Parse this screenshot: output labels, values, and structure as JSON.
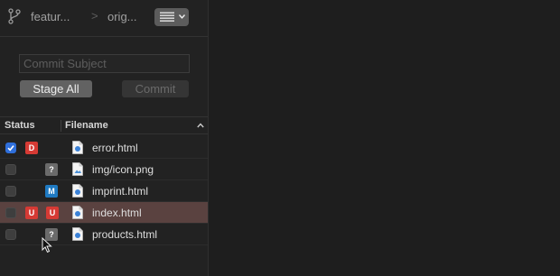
{
  "toolbar": {
    "branch_icon": "branch-icon",
    "branch": "featur...",
    "separator": ">",
    "remote": "orig...",
    "view_menu_icon": "list-icon"
  },
  "commit": {
    "subject_placeholder": "Commit Subject",
    "subject_value": "",
    "stage_all_label": "Stage All",
    "commit_label": "Commit"
  },
  "table": {
    "columns": {
      "status": "Status",
      "filename": "Filename"
    },
    "rows": [
      {
        "checked": true,
        "badges": [
          "D"
        ],
        "name": "error.html",
        "icon": "html-file-icon",
        "selected": false
      },
      {
        "checked": false,
        "badges": [
          "?"
        ],
        "name": "img/icon.png",
        "icon": "image-file-icon",
        "selected": false
      },
      {
        "checked": false,
        "badges": [
          "M"
        ],
        "name": "imprint.html",
        "icon": "html-file-icon",
        "selected": false
      },
      {
        "checked": false,
        "badges": [
          "U",
          "U"
        ],
        "name": "index.html",
        "icon": "html-file-icon",
        "selected": true
      },
      {
        "checked": false,
        "badges": [
          "?"
        ],
        "name": "products.html",
        "icon": "html-file-icon",
        "selected": false
      }
    ]
  },
  "colors": {
    "deleted": "#d63a34",
    "untracked": "#6b6b6b",
    "modified": "#1f7ac2",
    "unmerged": "#d63a34",
    "checkbox_checked": "#2f6fdb",
    "selected_row": "#5a4240"
  }
}
